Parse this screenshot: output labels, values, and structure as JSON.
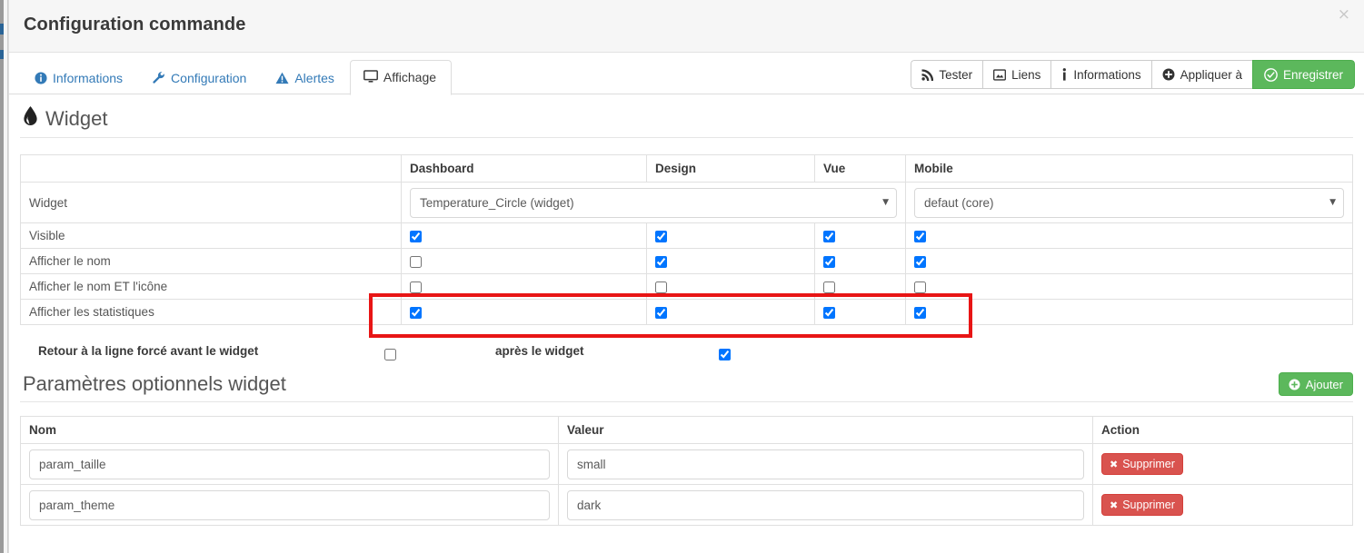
{
  "modal": {
    "title": "Configuration commande",
    "close_icon": "close-icon",
    "close_label": "×"
  },
  "tabs": [
    {
      "label": "Informations",
      "icon": "info-circle-icon",
      "active": false
    },
    {
      "label": "Configuration",
      "icon": "wrench-icon",
      "active": false
    },
    {
      "label": "Alertes",
      "icon": "warning-triangle-icon",
      "active": false
    },
    {
      "label": "Affichage",
      "icon": "desktop-icon",
      "active": true
    }
  ],
  "actions": [
    {
      "label": "Tester",
      "icon": "rss-icon",
      "style": "default"
    },
    {
      "label": "Liens",
      "icon": "link-image-icon",
      "style": "default"
    },
    {
      "label": "Informations",
      "icon": "info-icon",
      "style": "default"
    },
    {
      "label": "Appliquer à",
      "icon": "plus-circle-icon",
      "style": "default"
    },
    {
      "label": "Enregistrer",
      "icon": "check-circle-icon",
      "style": "primary"
    }
  ],
  "widget_section": {
    "legend": "Widget",
    "legend_icon": "tint-drop-icon",
    "columns": [
      "",
      "Dashboard",
      "Design",
      "Vue",
      "Mobile"
    ],
    "widget_row": {
      "label": "Widget",
      "dashboard_select": "Temperature_Circle (widget)",
      "mobile_select": "defaut (core)"
    },
    "checkbox_rows": [
      {
        "label": "Visible",
        "dashboard": true,
        "design": true,
        "vue": true,
        "mobile": true
      },
      {
        "label": "Afficher le nom",
        "dashboard": false,
        "design": true,
        "vue": true,
        "mobile": true
      },
      {
        "label": "Afficher le nom ET l'icône",
        "dashboard": false,
        "design": false,
        "vue": false,
        "mobile": false
      },
      {
        "label": "Afficher les statistiques",
        "dashboard": true,
        "design": true,
        "vue": true,
        "mobile": true
      }
    ],
    "highlight_color": "#e81515",
    "highlighted_row": "Afficher les statistiques"
  },
  "line_break": {
    "label_before": "Retour à la ligne forcé avant le widget",
    "checked_before": false,
    "label_after": "après le widget",
    "checked_after": true
  },
  "params_section": {
    "legend": "Paramètres optionnels widget",
    "add_label": "Ajouter",
    "add_icon": "plus-circle-icon",
    "columns": [
      "Nom",
      "Valeur",
      "Action"
    ],
    "rows": [
      {
        "nom": "param_taille",
        "valeur": "small",
        "action_label": "Supprimer",
        "action_icon": "times-icon"
      },
      {
        "nom": "param_theme",
        "valeur": "dark",
        "action_label": "Supprimer",
        "action_icon": "times-icon"
      }
    ]
  },
  "colors": {
    "link": "#337ab7",
    "primary_green": "#5cb85c",
    "danger_red": "#d9534f",
    "highlight_red": "#e81515",
    "header_bg": "#f6f6f6"
  }
}
